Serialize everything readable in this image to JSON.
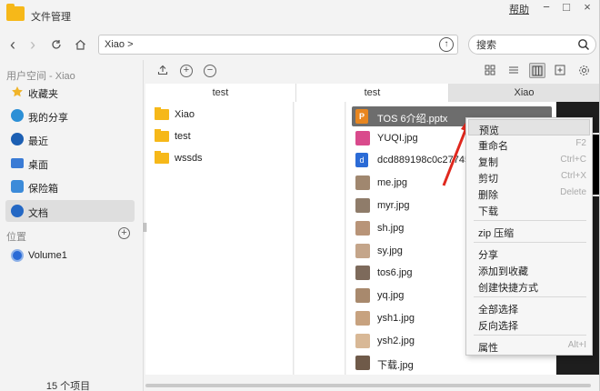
{
  "titlebar": {
    "title": "文件管理",
    "help": "帮助",
    "minimize": "−",
    "maximize": "□",
    "close": "×"
  },
  "nav": {
    "back": "‹",
    "forward": "›",
    "path": "Xiao >",
    "search_placeholder": "搜索"
  },
  "sidebar": {
    "user_section": "用户空间 - Xiao",
    "items": [
      {
        "label": "收藏夹",
        "icon": "star-icon",
        "color": "#f0b429"
      },
      {
        "label": "我的分享",
        "icon": "share-icon",
        "color": "#2b8fd6"
      },
      {
        "label": "最近",
        "icon": "clock-icon",
        "color": "#1c5fb3"
      },
      {
        "label": "桌面",
        "icon": "desktop-icon",
        "color": "#3a7bd5"
      },
      {
        "label": "保险箱",
        "icon": "safe-icon",
        "color": "#3c8bd9"
      },
      {
        "label": "文档",
        "icon": "document-icon",
        "color": "#2468c4"
      }
    ],
    "location_section": "位置",
    "locations": [
      {
        "label": "Volume1",
        "icon": "disk-icon",
        "color": "#2b6bd6"
      }
    ],
    "status": "15 个项目"
  },
  "columns": {
    "headers": [
      "test",
      "test",
      "Xiao"
    ],
    "col1": [
      "Xiao",
      "test",
      "wssds"
    ],
    "files": [
      {
        "name": "TOS 6介绍.pptx",
        "type": "ppt",
        "selected": true
      },
      {
        "name": "YUQI.jpg",
        "color": "#d94a8c"
      },
      {
        "name": "dcd889198c0c27745",
        "type": "doc"
      },
      {
        "name": "me.jpg",
        "color": "#a0876f"
      },
      {
        "name": "myr.jpg",
        "color": "#8f7c6a"
      },
      {
        "name": "sh.jpg",
        "color": "#b89478"
      },
      {
        "name": "sy.jpg",
        "color": "#c4a58a"
      },
      {
        "name": "tos6.jpg",
        "color": "#7d6a5b"
      },
      {
        "name": "yq.jpg",
        "color": "#a8896d"
      },
      {
        "name": "ysh1.jpg",
        "color": "#c7a27f"
      },
      {
        "name": "ysh2.jpg",
        "color": "#d8b896"
      },
      {
        "name": "下载.jpg",
        "color": "#6f5a49"
      }
    ]
  },
  "context_menu": {
    "items": [
      {
        "label": "预览",
        "shortcut": "",
        "highlight": true
      },
      {
        "label": "重命名",
        "shortcut": "F2"
      },
      {
        "label": "复制",
        "shortcut": "Ctrl+C"
      },
      {
        "label": "剪切",
        "shortcut": "Ctrl+X"
      },
      {
        "label": "删除",
        "shortcut": "Delete"
      },
      {
        "label": "下载",
        "shortcut": ""
      },
      {
        "label": "zip 压缩",
        "shortcut": ""
      },
      {
        "label": "分享",
        "shortcut": ""
      },
      {
        "label": "添加到收藏",
        "shortcut": ""
      },
      {
        "label": "创建快捷方式",
        "shortcut": ""
      },
      {
        "label": "全部选择",
        "shortcut": ""
      },
      {
        "label": "反向选择",
        "shortcut": ""
      },
      {
        "label": "属性",
        "shortcut": "Alt+I"
      }
    ]
  },
  "colors": {
    "accent_red": "#e0281e",
    "folder": "#f6b819"
  }
}
